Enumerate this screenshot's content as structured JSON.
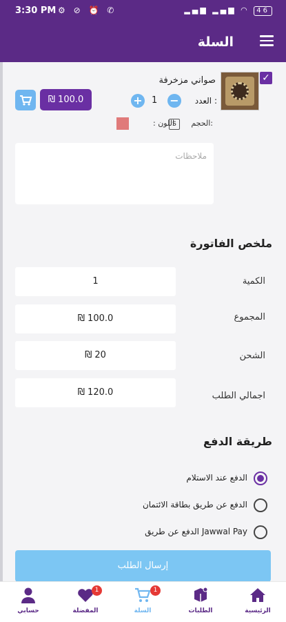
{
  "status_bar": {
    "time": "3:30 PM",
    "icons": [
      "settings-icon",
      "privacy-icon",
      "alarm-icon",
      "whatsapp-icon"
    ],
    "battery": "46"
  },
  "header": {
    "title": "السلة",
    "menu_icon": "hamburger-icon"
  },
  "cart_item": {
    "checked": true,
    "name": "صواني مزخرفة",
    "qty_label": "العدد :",
    "qty_value": "1",
    "price": "₪ 100.0",
    "size_label": "الحجم:",
    "size_value": "S",
    "color_label": ": اللون",
    "color_value": "#e07a7a",
    "notes_placeholder": "ملاحظات"
  },
  "summary": {
    "title": "ملخص الفاتورة",
    "rows": [
      {
        "label": "الكمية",
        "value": "1"
      },
      {
        "label": "المجموع",
        "value": "₪ 100.0"
      },
      {
        "label": "الشحن",
        "value": "₪ 20"
      },
      {
        "label": "اجمالي الطلب",
        "value": "₪ 120.0"
      }
    ]
  },
  "payment": {
    "title": "طريقة الدفع",
    "options": [
      {
        "label": "الدفع عند الاستلام",
        "selected": true
      },
      {
        "label": "الدفع عن طريق بطاقة الائتمان",
        "selected": false
      },
      {
        "label": "الدفع عن طريق Jawwal Pay",
        "selected": false
      }
    ],
    "submit_label": "إرسال الطلب"
  },
  "bottom_nav": [
    {
      "label": "حسابي",
      "icon": "user-icon"
    },
    {
      "label": "المفضلة",
      "icon": "heart-icon",
      "badge": "1"
    },
    {
      "label": "السلة",
      "icon": "cart-icon",
      "badge": "1",
      "active": true
    },
    {
      "label": "الطلبات",
      "icon": "orders-icon"
    },
    {
      "label": "الرئيسية",
      "icon": "home-icon"
    }
  ],
  "colors": {
    "primary": "#5b2a86",
    "accent": "#6fb6f0",
    "badge": "#e53935"
  }
}
